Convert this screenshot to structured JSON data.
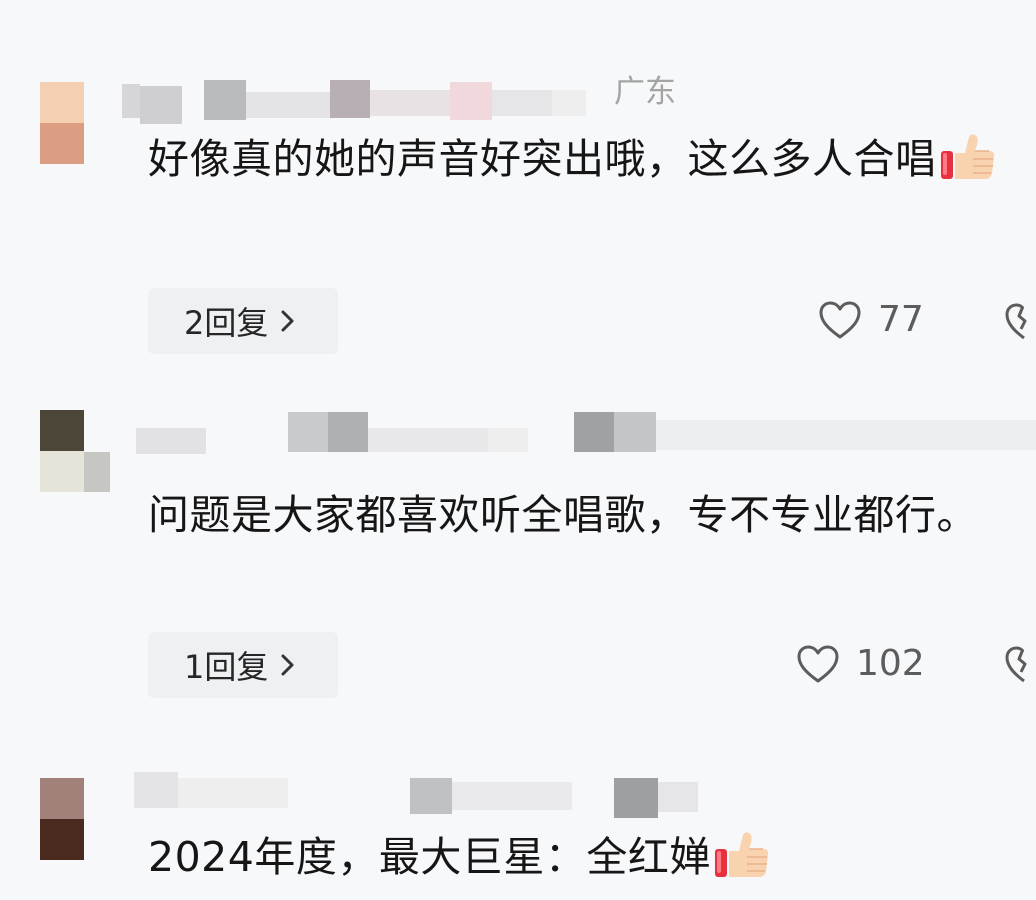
{
  "comments": [
    {
      "location": "广东",
      "text": "好像真的她的声音好突出哦，这么多人合唱",
      "reply_label": "2回复",
      "like_count": "77",
      "has_thumb_emoji": true
    },
    {
      "location": "",
      "text": "问题是大家都喜欢听全唱歌，专不专业都行。",
      "reply_label": "1回复",
      "like_count": "102",
      "has_thumb_emoji": false
    },
    {
      "location": "",
      "text": "2024年度，最大巨星：全红婵",
      "reply_label": "",
      "like_count": "",
      "has_thumb_emoji": true
    }
  ],
  "icons": {
    "like": "heart-outline-icon",
    "dislike": "broken-heart-icon",
    "reply_chevron": "chevron-right-icon",
    "emoji": "thumbs-up-emoji-icon"
  },
  "colors": {
    "background": "#f7f8fa",
    "text": "#161616",
    "meta": "#a4a4a4",
    "reply_bg": "#eef0f2",
    "icon": "#5c5c5c"
  }
}
